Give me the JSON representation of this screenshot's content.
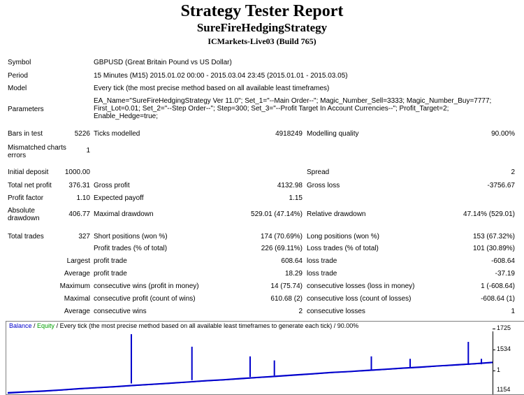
{
  "header": {
    "title": "Strategy Tester Report",
    "strategy": "SureFireHedgingStrategy",
    "server": "ICMarkets-Live03 (Build 765)"
  },
  "info": {
    "symbol_label": "Symbol",
    "symbol_value": "GBPUSD (Great Britain Pound vs US Dollar)",
    "period_label": "Period",
    "period_value": "15 Minutes (M15) 2015.01.02 00:00 - 2015.03.04 23:45 (2015.01.01 - 2015.03.05)",
    "model_label": "Model",
    "model_value": "Every tick (the most precise method based on all available least timeframes)",
    "params_label": "Parameters",
    "params_value": "EA_Name=\"SureFireHedgingStrategy Ver 11.0\"; Set_1=\"--Main Order--\"; Magic_Number_Sell=3333; Magic_Number_Buy=7777; First_Lot=0.01; Set_2=\"--Step Order--\"; Step=300; Set_3=\"--Profit Target In Account Currencies--\"; Profit_Target=2; Enable_Hedge=true;"
  },
  "bars": {
    "bars_label": "Bars in test",
    "bars_value": "5226",
    "ticks_label": "Ticks modelled",
    "ticks_value": "4918249",
    "quality_label": "Modelling quality",
    "quality_value": "90.00%"
  },
  "mismatched": {
    "label": "Mismatched charts errors",
    "value": "1"
  },
  "stats": {
    "deposit_label": "Initial deposit",
    "deposit_value": "1000.00",
    "spread_label": "Spread",
    "spread_value": "2",
    "net_label": "Total net profit",
    "net_value": "376.31",
    "gross_profit_label": "Gross profit",
    "gross_profit_value": "4132.98",
    "gross_loss_label": "Gross loss",
    "gross_loss_value": "-3756.67",
    "pf_label": "Profit factor",
    "pf_value": "1.10",
    "payoff_label": "Expected payoff",
    "payoff_value": "1.15",
    "abs_dd_label": "Absolute drawdown",
    "abs_dd_value": "406.77",
    "max_dd_label": "Maximal drawdown",
    "max_dd_value": "529.01 (47.14%)",
    "rel_dd_label": "Relative drawdown",
    "rel_dd_value": "47.14% (529.01)"
  },
  "trades": {
    "total_label": "Total trades",
    "total_value": "327",
    "short_label": "Short positions (won %)",
    "short_value": "174 (70.69%)",
    "long_label": "Long positions (won %)",
    "long_value": "153 (67.32%)",
    "profit_trades_label": "Profit trades (% of total)",
    "profit_trades_value": "226 (69.11%)",
    "loss_trades_label": "Loss trades (% of total)",
    "loss_trades_value": "101 (30.89%)",
    "largest_label": "Largest",
    "largest_pt_label": "profit trade",
    "largest_pt_value": "608.64",
    "largest_lt_label": "loss trade",
    "largest_lt_value": "-608.64",
    "average_label": "Average",
    "average_pt_label": "profit trade",
    "average_pt_value": "18.29",
    "average_lt_label": "loss trade",
    "average_lt_value": "-37.19",
    "maximum_label": "Maximum",
    "max_cw_label": "consecutive wins (profit in money)",
    "max_cw_value": "14 (75.74)",
    "max_cl_label": "consecutive losses (loss in money)",
    "max_cl_value": "1 (-608.64)",
    "maximal_label": "Maximal",
    "mxl_cp_label": "consecutive profit (count of wins)",
    "mxl_cp_value": "610.68 (2)",
    "mxl_cl_label": "consecutive loss (count of losses)",
    "mxl_cl_value": "-608.64 (1)",
    "avg2_label": "Average",
    "avg_cw_label": "consecutive wins",
    "avg_cw_value": "2",
    "avg_cl_label": "consecutive losses",
    "avg_cl_value": "1"
  },
  "chart": {
    "legend_balance": "Balance",
    "legend_sep": " / ",
    "legend_equity": "Equity",
    "legend_rest": " / Every tick (the most precise method based on all available least timeframes to generate each tick) / 90.00%",
    "yticks": [
      "1725",
      "1534",
      "1",
      "1154"
    ],
    "colors": {
      "balance": "#0000cc",
      "equity": "#00a000"
    }
  },
  "chart_data": {
    "type": "line",
    "title": "",
    "y_ticks": [
      1154,
      1534,
      1725
    ],
    "series": [
      {
        "name": "Balance",
        "values": [
          1000,
          1010,
          1022,
          1035,
          1050,
          1062,
          1075,
          1090,
          1104,
          1118,
          1132,
          1148,
          1160,
          1176,
          1190,
          1205,
          1220,
          1235,
          1250,
          1262,
          1276,
          1290,
          1305,
          1318,
          1332,
          1346,
          1360,
          1376
        ]
      },
      {
        "name": "Equity",
        "values": [
          990,
          1005,
          1015,
          1030,
          1045,
          1058,
          1070,
          1085,
          1100,
          1112,
          1128,
          1142,
          1155,
          1170,
          1185,
          1198,
          1214,
          1230,
          1245,
          1258,
          1270,
          1285,
          1300,
          1312,
          1328,
          1340,
          1355,
          1370
        ]
      }
    ],
    "spikes": [
      {
        "pos": 0.255,
        "value": 1725
      },
      {
        "pos": 0.38,
        "value": 1570
      },
      {
        "pos": 0.5,
        "value": 1450
      },
      {
        "pos": 0.55,
        "value": 1400
      },
      {
        "pos": 0.75,
        "value": 1450
      },
      {
        "pos": 0.83,
        "value": 1420
      },
      {
        "pos": 0.95,
        "value": 1630
      },
      {
        "pos": 0.977,
        "value": 1420
      }
    ]
  }
}
